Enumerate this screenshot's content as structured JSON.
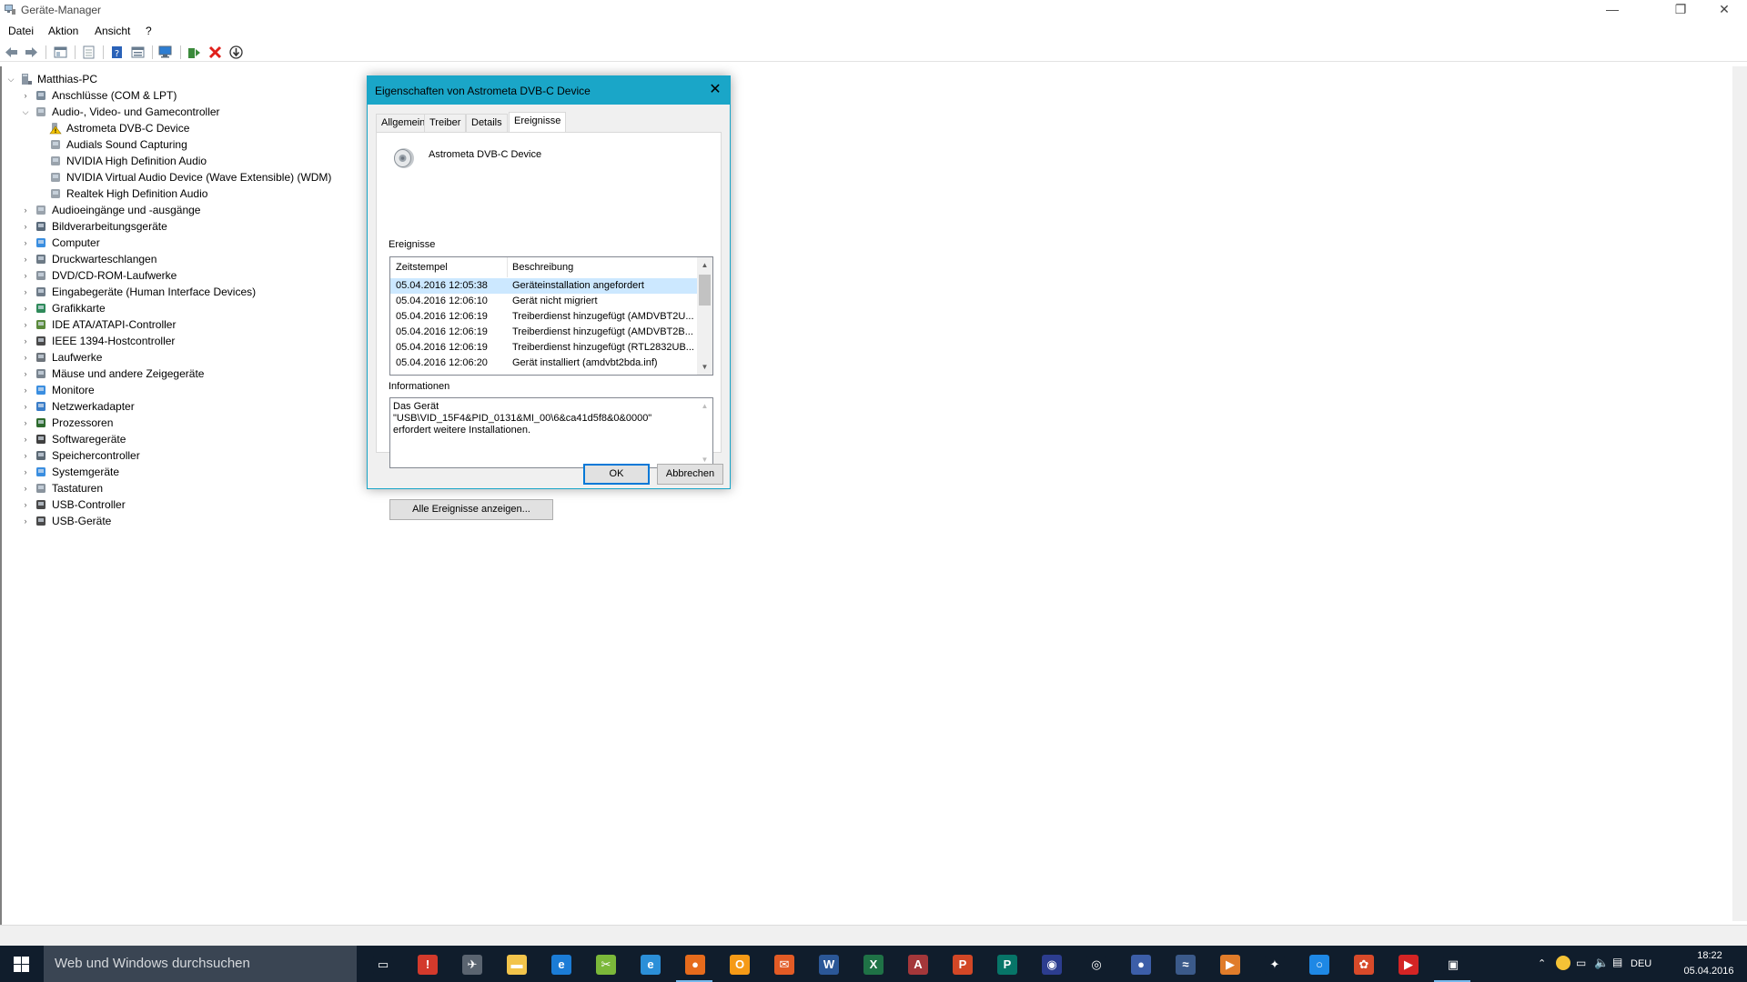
{
  "window": {
    "title": "Geräte-Manager",
    "min_glyph": "—",
    "restore_glyph": "❐",
    "close_glyph": "✕"
  },
  "menu": {
    "items": [
      "Datei",
      "Aktion",
      "Ansicht",
      "?"
    ]
  },
  "toolbar": {
    "icons": [
      "back-icon",
      "forward-icon",
      "show-hide-console-tree-icon",
      "properties-icon",
      "help-icon",
      "view-icon",
      "monitor-scan-icon",
      "update-driver-icon",
      "uninstall-icon",
      "disable-icon"
    ]
  },
  "tree": {
    "root": "Matthias-PC",
    "items": [
      {
        "label": "Anschlüsse (COM & LPT)",
        "level": 1,
        "expanded": false,
        "icon": "port-icon"
      },
      {
        "label": "Audio-, Video- und Gamecontroller",
        "level": 1,
        "expanded": true,
        "icon": "speaker-icon"
      },
      {
        "label": "Astrometa DVB-C Device",
        "level": 2,
        "icon": "warning-speaker-icon"
      },
      {
        "label": "Audials Sound Capturing",
        "level": 2,
        "icon": "speaker-icon"
      },
      {
        "label": "NVIDIA High Definition Audio",
        "level": 2,
        "icon": "speaker-icon"
      },
      {
        "label": "NVIDIA Virtual Audio Device (Wave Extensible) (WDM)",
        "level": 2,
        "icon": "speaker-icon"
      },
      {
        "label": "Realtek High Definition Audio",
        "level": 2,
        "icon": "speaker-icon"
      },
      {
        "label": "Audioeingänge und -ausgänge",
        "level": 1,
        "expanded": false,
        "icon": "speaker-icon"
      },
      {
        "label": "Bildverarbeitungsgeräte",
        "level": 1,
        "expanded": false,
        "icon": "camera-icon"
      },
      {
        "label": "Computer",
        "level": 1,
        "expanded": false,
        "icon": "computer-icon"
      },
      {
        "label": "Druckwarteschlangen",
        "level": 1,
        "expanded": false,
        "icon": "printer-icon"
      },
      {
        "label": "DVD/CD-ROM-Laufwerke",
        "level": 1,
        "expanded": false,
        "icon": "disc-icon"
      },
      {
        "label": "Eingabegeräte (Human Interface Devices)",
        "level": 1,
        "expanded": false,
        "icon": "hid-icon"
      },
      {
        "label": "Grafikkarte",
        "level": 1,
        "expanded": false,
        "icon": "display-adapter-icon"
      },
      {
        "label": "IDE ATA/ATAPI-Controller",
        "level": 1,
        "expanded": false,
        "icon": "ide-icon"
      },
      {
        "label": "IEEE 1394-Hostcontroller",
        "level": 1,
        "expanded": false,
        "icon": "firewire-icon"
      },
      {
        "label": "Laufwerke",
        "level": 1,
        "expanded": false,
        "icon": "drive-icon"
      },
      {
        "label": "Mäuse und andere Zeigegeräte",
        "level": 1,
        "expanded": false,
        "icon": "mouse-icon"
      },
      {
        "label": "Monitore",
        "level": 1,
        "expanded": false,
        "icon": "monitor-icon"
      },
      {
        "label": "Netzwerkadapter",
        "level": 1,
        "expanded": false,
        "icon": "network-icon"
      },
      {
        "label": "Prozessoren",
        "level": 1,
        "expanded": false,
        "icon": "cpu-icon"
      },
      {
        "label": "Softwaregeräte",
        "level": 1,
        "expanded": false,
        "icon": "software-device-icon"
      },
      {
        "label": "Speichercontroller",
        "level": 1,
        "expanded": false,
        "icon": "storage-icon"
      },
      {
        "label": "Systemgeräte",
        "level": 1,
        "expanded": false,
        "icon": "system-icon"
      },
      {
        "label": "Tastaturen",
        "level": 1,
        "expanded": false,
        "icon": "keyboard-icon"
      },
      {
        "label": "USB-Controller",
        "level": 1,
        "expanded": false,
        "icon": "usb-icon"
      },
      {
        "label": "USB-Geräte",
        "level": 1,
        "expanded": false,
        "icon": "usb-icon"
      }
    ]
  },
  "dialog": {
    "title": "Eigenschaften von Astrometa DVB-C Device",
    "close_glyph": "✕",
    "tabs": [
      "Allgemein",
      "Treiber",
      "Details",
      "Ereignisse"
    ],
    "active_tab": "Ereignisse",
    "device_name": "Astrometa DVB-C Device",
    "events_label": "Ereignisse",
    "columns": [
      "Zeitstempel",
      "Beschreibung"
    ],
    "events": [
      {
        "time": "05.04.2016 12:05:38",
        "desc": "Geräteinstallation angefordert",
        "selected": true
      },
      {
        "time": "05.04.2016 12:06:10",
        "desc": "Gerät nicht migriert"
      },
      {
        "time": "05.04.2016 12:06:19",
        "desc": "Treiberdienst hinzugefügt (AMDVBT2U..."
      },
      {
        "time": "05.04.2016 12:06:19",
        "desc": "Treiberdienst hinzugefügt (AMDVBT2B..."
      },
      {
        "time": "05.04.2016 12:06:19",
        "desc": "Treiberdienst hinzugefügt (RTL2832UB..."
      },
      {
        "time": "05.04.2016 12:06:20",
        "desc": "Gerät installiert (amdvbt2bda.inf)"
      }
    ],
    "info_label": "Informationen",
    "info_text": "Das Gerät \"USB\\VID_15F4&PID_0131&MI_00\\6&ca41d5f8&0&0000\" erfordert weitere Installationen.",
    "show_all_button": "Alle Ereignisse anzeigen...",
    "ok_button": "OK",
    "cancel_button": "Abbrechen"
  },
  "taskbar": {
    "search_placeholder": "Web und Windows durchsuchen",
    "apps": [
      {
        "name": "task-view-icon",
        "color": "#101d2c",
        "glyph": "▭"
      },
      {
        "name": "app-red-icon",
        "color": "#d33a2c",
        "glyph": "!"
      },
      {
        "name": "app-tool-icon",
        "color": "#5a6470",
        "glyph": "✈"
      },
      {
        "name": "file-explorer-icon",
        "color": "#f2c44b",
        "glyph": "▬"
      },
      {
        "name": "edge-icon",
        "color": "#1b7cd6",
        "glyph": "e"
      },
      {
        "name": "app-green-icon",
        "color": "#7bb83a",
        "glyph": "✂"
      },
      {
        "name": "internet-explorer-icon",
        "color": "#2b8fd8",
        "glyph": "e"
      },
      {
        "name": "firefox-icon",
        "color": "#e66b1c",
        "glyph": "●"
      },
      {
        "name": "outlook-icon",
        "color": "#f59a16",
        "glyph": "O"
      },
      {
        "name": "mail-icon",
        "color": "#e25b25",
        "glyph": "✉"
      },
      {
        "name": "word-icon",
        "color": "#2b5797",
        "glyph": "W"
      },
      {
        "name": "excel-icon",
        "color": "#1f7246",
        "glyph": "X"
      },
      {
        "name": "access-icon",
        "color": "#a4373a",
        "glyph": "A"
      },
      {
        "name": "powerpoint-icon",
        "color": "#d24726",
        "glyph": "P"
      },
      {
        "name": "publisher-icon",
        "color": "#077568",
        "glyph": "P"
      },
      {
        "name": "webcam-icon",
        "color": "#2c3d8f",
        "glyph": "◉"
      },
      {
        "name": "app-circle-icon",
        "color": "#101d2c",
        "glyph": "◎"
      },
      {
        "name": "globe-icon",
        "color": "#3c5ea8",
        "glyph": "●"
      },
      {
        "name": "steam-icon",
        "color": "#3b5a8a",
        "glyph": "≈"
      },
      {
        "name": "media-player-icon",
        "color": "#e07c2a",
        "glyph": "▶"
      },
      {
        "name": "satellite-icon",
        "color": "#101d2c",
        "glyph": "✦"
      },
      {
        "name": "app-blue-circle-icon",
        "color": "#1e88e5",
        "glyph": "○"
      },
      {
        "name": "app-swirl-icon",
        "color": "#d84a2a",
        "glyph": "✿"
      },
      {
        "name": "mp3-icon",
        "color": "#d42424",
        "glyph": "▶"
      },
      {
        "name": "device-manager-icon",
        "color": "#101d2c",
        "glyph": "▣"
      }
    ],
    "tray": {
      "language": "DEU",
      "time": "18:22",
      "date": "05.04.2016"
    }
  }
}
